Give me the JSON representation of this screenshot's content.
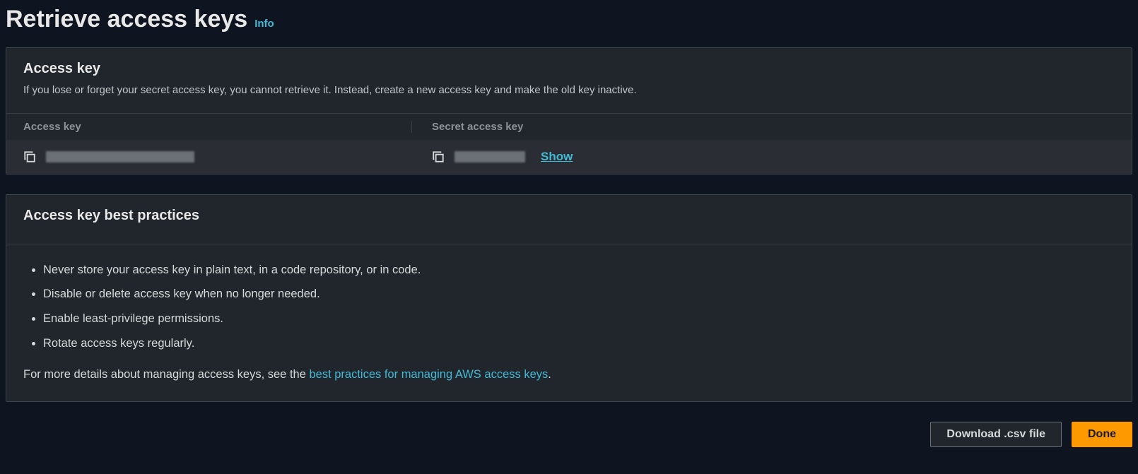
{
  "header": {
    "title": "Retrieve access keys",
    "info_label": "Info"
  },
  "access_key_panel": {
    "title": "Access key",
    "description": "If you lose or forget your secret access key, you cannot retrieve it. Instead, create a new access key and make the old key inactive.",
    "columns": {
      "access_key": "Access key",
      "secret_access_key": "Secret access key"
    },
    "row": {
      "access_key_value": "",
      "secret_value": "",
      "show_label": "Show"
    }
  },
  "best_practices_panel": {
    "title": "Access key best practices",
    "items": [
      "Never store your access key in plain text, in a code repository, or in code.",
      "Disable or delete access key when no longer needed.",
      "Enable least-privilege permissions.",
      "Rotate access keys regularly."
    ],
    "more_prefix": "For more details about managing access keys, see the ",
    "more_link": "best practices for managing AWS access keys",
    "more_suffix": "."
  },
  "footer": {
    "download_label": "Download .csv file",
    "done_label": "Done"
  },
  "colors": {
    "accent_link": "#44b9d6",
    "primary_button": "#ff9900",
    "background": "#0f1520",
    "panel": "#21252c"
  }
}
